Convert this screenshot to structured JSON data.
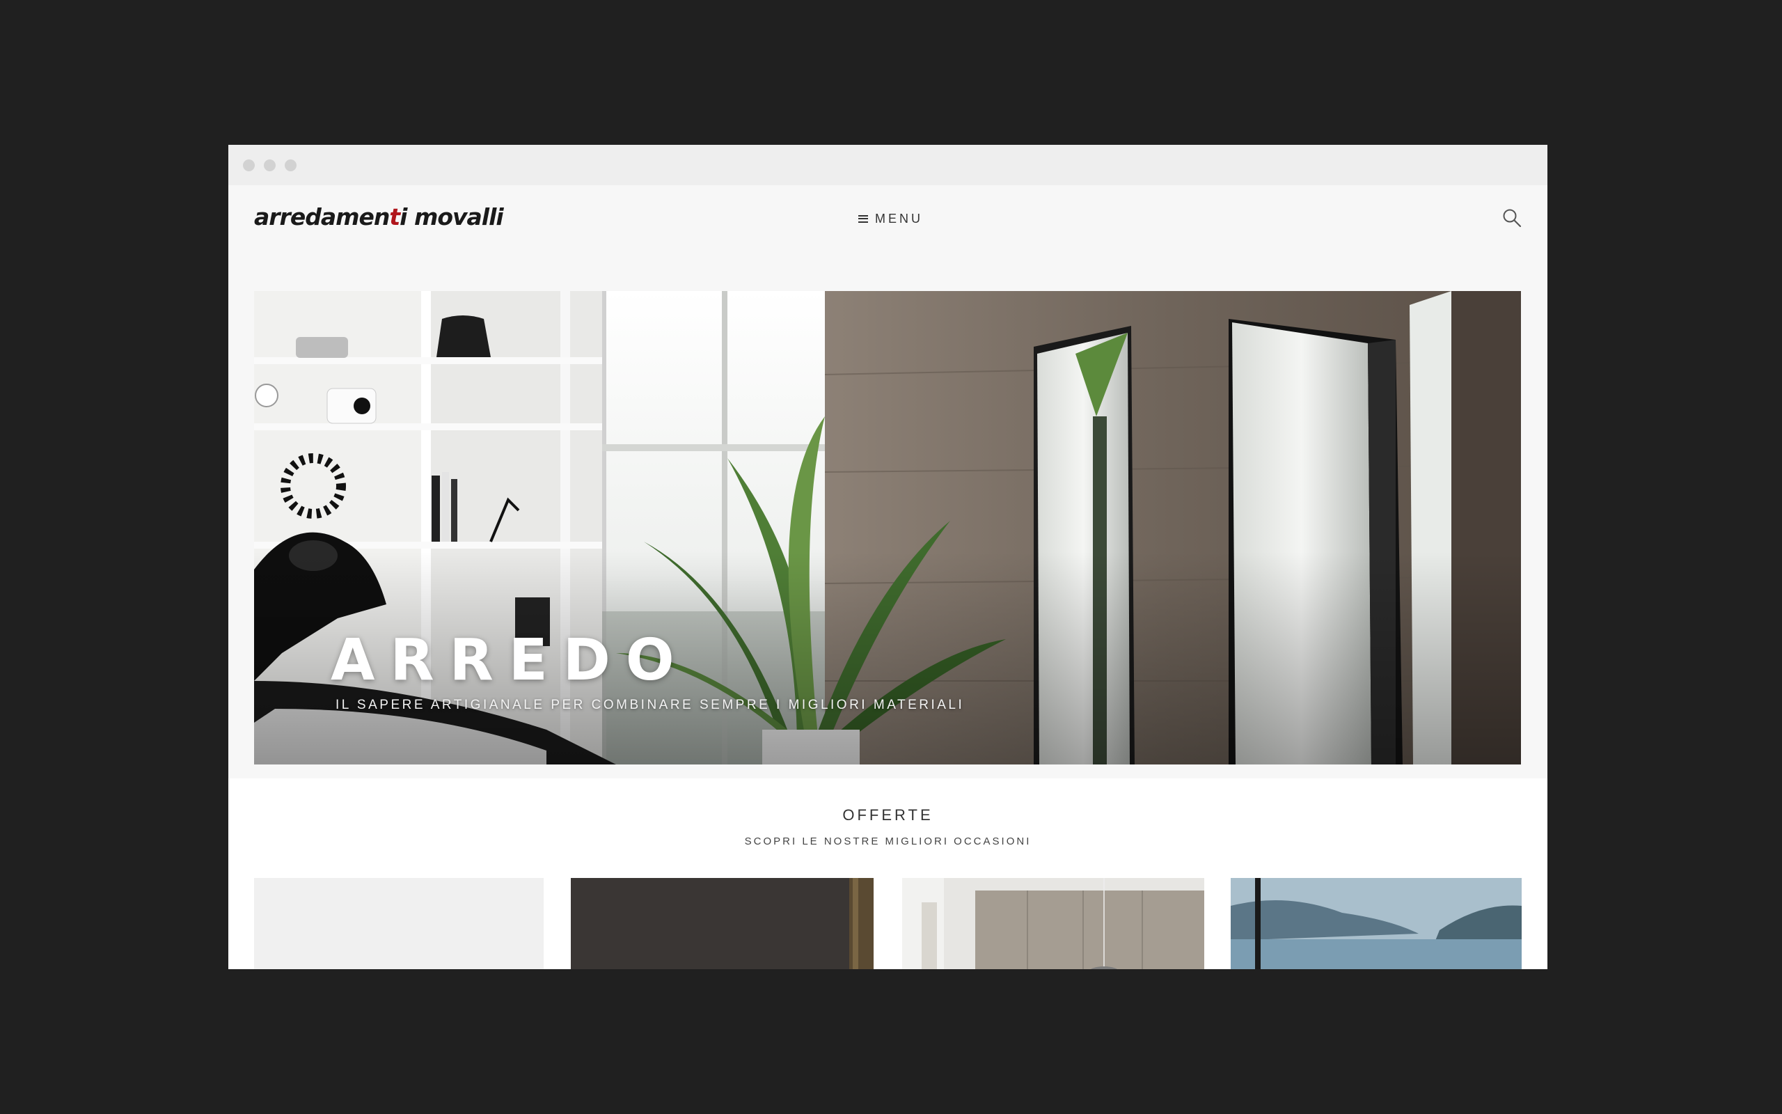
{
  "brand": {
    "logo_text_1": "arredamen",
    "logo_text_accent": "t",
    "logo_text_2": "i movalli",
    "accent_color": "#b0161c"
  },
  "nav": {
    "menu_icon": "hamburger-icon",
    "menu_label": "MENU",
    "search_icon": "search-icon"
  },
  "hero": {
    "title": "ARREDO",
    "subtitle": "IL SAPERE ARTIGIANALE PER COMBINARE SEMPRE I MIGLIORI MATERIALI",
    "slides_count": 3,
    "active_slide": 2
  },
  "offers": {
    "title": "OFFERTE",
    "subtitle": "SCOPRI LE NOSTRE MIGLIORI OCCASIONI"
  }
}
